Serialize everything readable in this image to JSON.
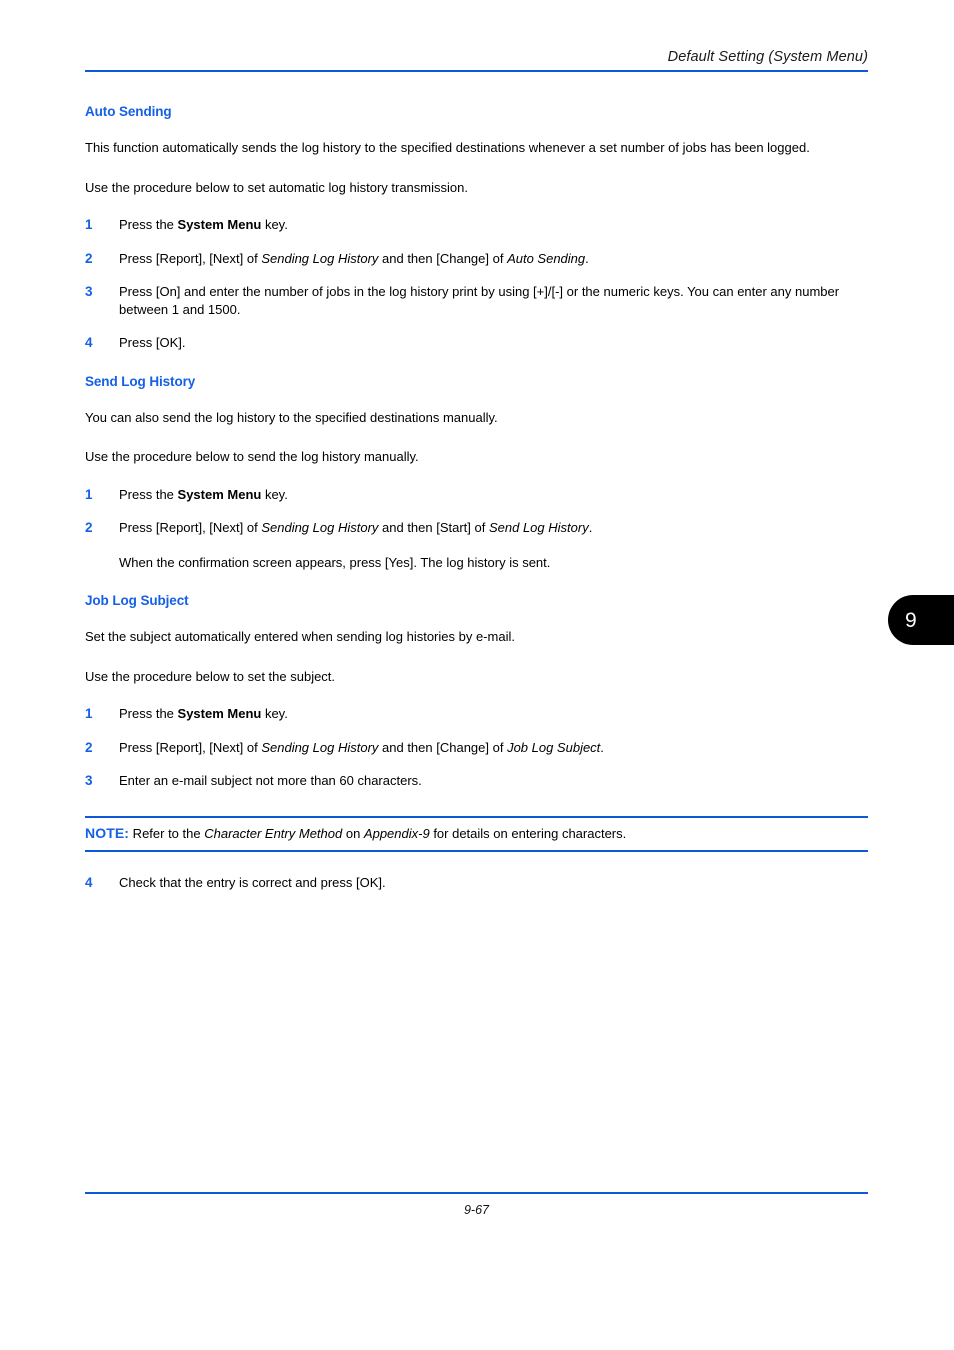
{
  "header": {
    "title": "Default Setting (System Menu)",
    "rule_color": "#0d59d8"
  },
  "theme": {
    "heading_blue": "#1560e6",
    "rule_blue": "#0d59d8",
    "text_black": "#000000",
    "tab_background": "#000000",
    "tab_text": "#ffffff"
  },
  "chapter_tab": {
    "number": "9"
  },
  "sections": [
    {
      "id": "auto-sending",
      "heading": "Auto Sending",
      "intro": "This function automatically sends the log history to the specified destinations whenever a set number of jobs has been logged.",
      "lead_in": "Use the procedure below to set automatic log history transmission.",
      "steps": [
        {
          "number": "1",
          "parts": [
            {
              "type": "text",
              "value": "Press the "
            },
            {
              "type": "bold",
              "value": "System Menu"
            },
            {
              "type": "text",
              "value": " key."
            }
          ]
        },
        {
          "number": "2",
          "parts": [
            {
              "type": "text",
              "value": "Press [Report], [Next] of "
            },
            {
              "type": "italic",
              "value": "Sending Log History"
            },
            {
              "type": "text",
              "value": " and then [Change] of "
            },
            {
              "type": "italic",
              "value": "Auto Sending"
            },
            {
              "type": "text",
              "value": "."
            }
          ]
        },
        {
          "number": "3",
          "parts": [
            {
              "type": "text",
              "value": "Press [On] and enter the number of jobs in the log history print by using [+]/[-] or the numeric keys. You can enter any number between 1 and 1500."
            }
          ]
        },
        {
          "number": "4",
          "parts": [
            {
              "type": "text",
              "value": "Press [OK]."
            }
          ]
        }
      ]
    },
    {
      "id": "send-log-history",
      "heading": "Send Log History",
      "intro": "You can also send the log history to the specified destinations manually.",
      "lead_in": "Use the procedure below to send the log history manually.",
      "steps": [
        {
          "number": "1",
          "parts": [
            {
              "type": "text",
              "value": "Press the "
            },
            {
              "type": "bold",
              "value": "System Menu"
            },
            {
              "type": "text",
              "value": " key."
            }
          ]
        },
        {
          "number": "2",
          "parts": [
            {
              "type": "text",
              "value": "Press [Report], [Next] of "
            },
            {
              "type": "italic",
              "value": "Sending Log History"
            },
            {
              "type": "text",
              "value": " and then [Start] of "
            },
            {
              "type": "italic",
              "value": "Send Log History"
            },
            {
              "type": "text",
              "value": "."
            }
          ],
          "sub": "When the confirmation screen appears, press [Yes]. The log history is sent."
        }
      ]
    },
    {
      "id": "job-log-subject",
      "heading": "Job Log Subject",
      "intro": "Set the subject automatically entered when sending log histories by e-mail.",
      "lead_in": "Use the procedure below to set the subject.",
      "steps": [
        {
          "number": "1",
          "parts": [
            {
              "type": "text",
              "value": "Press the "
            },
            {
              "type": "bold",
              "value": "System Menu"
            },
            {
              "type": "text",
              "value": " key."
            }
          ]
        },
        {
          "number": "2",
          "parts": [
            {
              "type": "text",
              "value": "Press [Report], [Next] of "
            },
            {
              "type": "italic",
              "value": "Sending Log History"
            },
            {
              "type": "text",
              "value": " and then [Change] of "
            },
            {
              "type": "italic",
              "value": "Job Log Subject"
            },
            {
              "type": "text",
              "value": "."
            }
          ]
        },
        {
          "number": "3",
          "parts": [
            {
              "type": "text",
              "value": "Enter an e-mail subject not more than 60 characters."
            }
          ]
        }
      ]
    }
  ],
  "note": {
    "label": "NOTE:",
    "parts": [
      {
        "type": "text",
        "value": " Refer to the "
      },
      {
        "type": "italic",
        "value": "Character Entry Method"
      },
      {
        "type": "text",
        "value": " on "
      },
      {
        "type": "italic",
        "value": "Appendix-9"
      },
      {
        "type": "text",
        "value": " for details on entering characters."
      }
    ]
  },
  "post_note_steps": [
    {
      "number": "4",
      "parts": [
        {
          "type": "text",
          "value": "Check that the entry is correct and press [OK]."
        }
      ]
    }
  ],
  "footer": {
    "page_number": "9-67"
  }
}
